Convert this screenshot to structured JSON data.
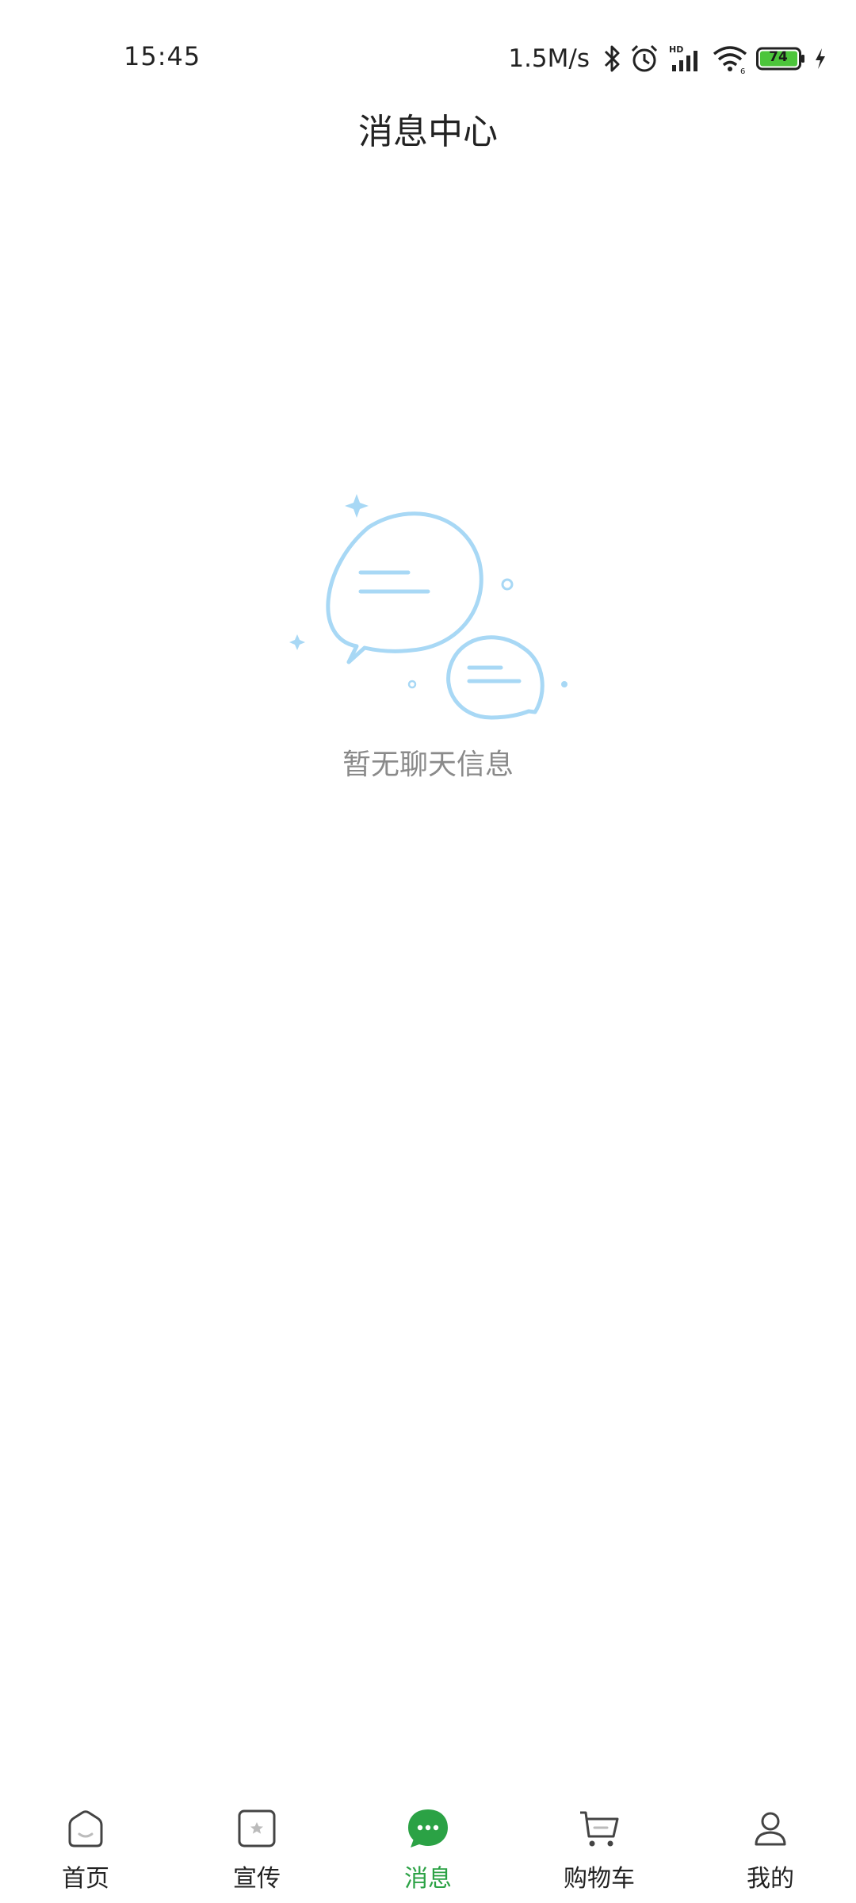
{
  "status_bar": {
    "time": "15:45",
    "net_speed": "1.5M/s",
    "battery_level": "74",
    "icons": [
      "bluetooth-icon",
      "alarm-icon",
      "hd-signal-icon",
      "wifi-icon",
      "battery-icon",
      "charging-icon"
    ]
  },
  "header": {
    "title": "消息中心"
  },
  "empty_state": {
    "message": "暂无聊天信息",
    "illustration": "chat-bubbles-icon"
  },
  "tabbar": {
    "active": "消息",
    "accent_color": "#2ba245",
    "tabs": [
      {
        "label": "首页",
        "icon": "home-icon"
      },
      {
        "label": "宣传",
        "icon": "promo-star-icon"
      },
      {
        "label": "消息",
        "icon": "message-icon"
      },
      {
        "label": "购物车",
        "icon": "cart-icon"
      },
      {
        "label": "我的",
        "icon": "user-icon"
      }
    ]
  }
}
